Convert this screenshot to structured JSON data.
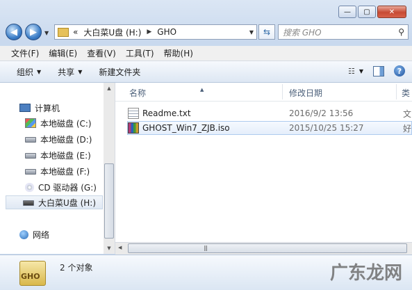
{
  "window": {
    "caption": {
      "min": "—",
      "max": "▢",
      "close": "✕"
    }
  },
  "address": {
    "prefix": "«",
    "crumbs": [
      "大白菜U盘 (H:)",
      "GHO"
    ],
    "search_placeholder": "搜索 GHO"
  },
  "menu": [
    "文件(F)",
    "编辑(E)",
    "查看(V)",
    "工具(T)",
    "帮助(H)"
  ],
  "toolbar": {
    "organize": "组织",
    "share": "共享",
    "new_folder": "新建文件夹"
  },
  "nav": {
    "computer": "计算机",
    "drives": [
      {
        "label": "本地磁盘 (C:)",
        "icon": "windows-drive-icon"
      },
      {
        "label": "本地磁盘 (D:)",
        "icon": "drive-icon"
      },
      {
        "label": "本地磁盘 (E:)",
        "icon": "drive-icon"
      },
      {
        "label": "本地磁盘 (F:)",
        "icon": "drive-icon"
      },
      {
        "label": "CD 驱动器 (G:)",
        "icon": "cd-drive-icon"
      },
      {
        "label": "大白菜U盘 (H:)",
        "icon": "usb-drive-icon"
      }
    ],
    "network": "网络"
  },
  "columns": {
    "name": "名称",
    "date": "修改日期",
    "type": "类"
  },
  "files": [
    {
      "name": "Readme.txt",
      "date": "2016/9/2 13:56",
      "type": "文",
      "icon": "text-file-icon"
    },
    {
      "name": "GHOST_Win7_ZJB.iso",
      "date": "2015/10/25 15:27",
      "type": "好",
      "icon": "iso-archive-icon"
    }
  ],
  "details": {
    "icon_label": "GHO",
    "count": "2 个对象"
  },
  "watermark": "广东龙网"
}
